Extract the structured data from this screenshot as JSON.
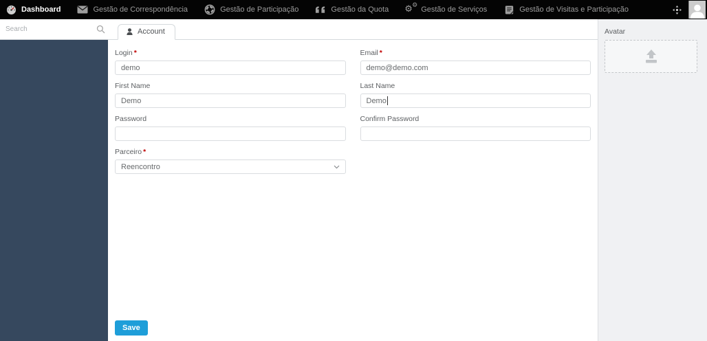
{
  "topbar": {
    "items": [
      {
        "label": "Dashboard",
        "icon": "gauge-icon",
        "active": true
      },
      {
        "label": "Gestão de Correspondência",
        "icon": "envelope-icon",
        "active": false
      },
      {
        "label": "Gestão de Participação",
        "icon": "life-ring-icon",
        "active": false
      },
      {
        "label": "Gestão da Quota",
        "icon": "quote-icon",
        "active": false
      },
      {
        "label": "Gestão de Serviços",
        "icon": "gears-icon",
        "active": false
      },
      {
        "label": "Gestão de Visitas e Participação",
        "icon": "book-icon",
        "active": false
      }
    ],
    "right_icons": [
      "expand-icon",
      "user-avatar"
    ]
  },
  "sidebar": {
    "search_placeholder": "Search"
  },
  "main": {
    "tabs": [
      {
        "label": "Account",
        "icon": "user-icon",
        "active": true
      }
    ],
    "form": {
      "fields": [
        {
          "label": "Login",
          "required": true,
          "value": "demo"
        },
        {
          "label": "Email",
          "required": true,
          "value": "demo@demo.com"
        },
        {
          "label": "First Name",
          "required": false,
          "value": "Demo"
        },
        {
          "label": "Last Name",
          "required": false,
          "value": "Demo",
          "focused": true
        },
        {
          "label": "Password",
          "required": false,
          "value": ""
        },
        {
          "label": "Confirm Password",
          "required": false,
          "value": ""
        },
        {
          "label": "Parceiro",
          "required": true,
          "value": "Reencontro",
          "type": "select"
        }
      ],
      "save_label": "Save"
    }
  },
  "avatar_panel": {
    "label": "Avatar",
    "icon": "upload-icon"
  },
  "colors": {
    "topbar_bg": "#040404",
    "sidebar_bg": "#36485e",
    "accent_blue": "#1e9ed9",
    "required_red": "#c00000",
    "panel_bg": "#f0f1f3"
  }
}
